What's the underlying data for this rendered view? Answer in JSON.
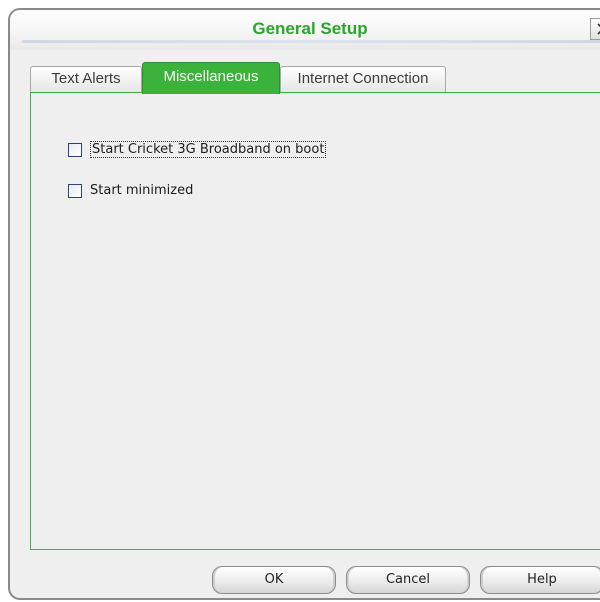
{
  "window": {
    "title": "General Setup"
  },
  "tabs": [
    {
      "label": "Text Alerts",
      "active": false
    },
    {
      "label": "Miscellaneous",
      "active": true
    },
    {
      "label": "Internet Connection",
      "active": false
    }
  ],
  "options": [
    {
      "label": "Start Cricket 3G Broadband on boot",
      "checked": false,
      "focused": true
    },
    {
      "label": "Start minimized",
      "checked": false,
      "focused": false
    }
  ],
  "buttons": {
    "ok": "OK",
    "cancel": "Cancel",
    "help": "Help"
  },
  "colors": {
    "accent": "#3bb23a",
    "title": "#2aa62a"
  },
  "icons": {
    "close": "close-icon"
  }
}
